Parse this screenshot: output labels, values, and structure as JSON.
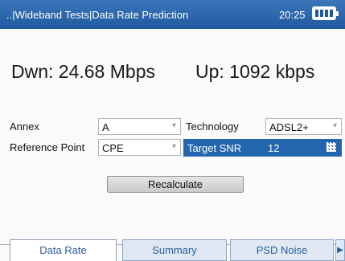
{
  "titlebar": {
    "path": "..|Wideband Tests|Data Rate Prediction",
    "time": "20:25"
  },
  "rates": {
    "down": "Dwn: 24.68 Mbps",
    "up": "Up: 1092 kbps"
  },
  "form": {
    "annex_label": "Annex",
    "annex_value": "A",
    "technology_label": "Technology",
    "technology_value": "ADSL2+",
    "ref_label": "Reference Point",
    "ref_value": "CPE",
    "snr_label": "Target SNR",
    "snr_value": "12"
  },
  "recalculate_label": "Recalculate",
  "tabs": [
    {
      "label": "Data Rate"
    },
    {
      "label": "Summary"
    },
    {
      "label": "PSD Noise"
    }
  ],
  "icons": {
    "battery": "battery-icon",
    "dropdown": "chevron-down-icon",
    "keypad": "keypad-icon",
    "tab_next": "triangle-right-icon"
  },
  "colors": {
    "titlebar": "#2466ae",
    "highlight": "#2466ae",
    "tab_text": "#2a5d9b"
  }
}
